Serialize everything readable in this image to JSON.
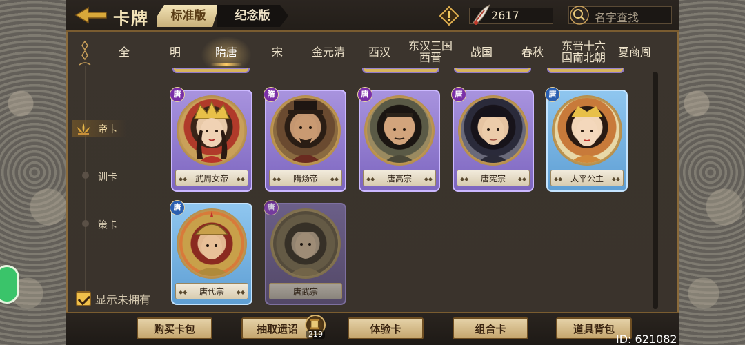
{
  "header": {
    "title": "卡牌",
    "edition_tabs": [
      {
        "label": "标准版",
        "active": true
      },
      {
        "label": "纪念版",
        "active": false
      }
    ],
    "currency_value": "2617",
    "search_placeholder": "名字查找"
  },
  "dynasty_tabs": [
    {
      "label": "全",
      "active": false
    },
    {
      "label": "明",
      "active": false
    },
    {
      "label": "隋唐",
      "active": true
    },
    {
      "label": "宋",
      "active": false
    },
    {
      "label": "金元清",
      "active": false
    },
    {
      "label": "西汉",
      "active": false
    },
    {
      "label": "东汉三国\n西晋",
      "active": false
    },
    {
      "label": "战国",
      "active": false
    },
    {
      "label": "春秋",
      "active": false
    },
    {
      "label": "东晋十六\n国南北朝",
      "active": false
    },
    {
      "label": "夏商周",
      "active": false
    }
  ],
  "side_nav": [
    {
      "label": "帝卡",
      "active": true
    },
    {
      "label": "训卡",
      "active": false
    },
    {
      "label": "策卡",
      "active": false
    }
  ],
  "cards": [
    {
      "name": "武周女帝",
      "badge": "唐",
      "frame": "purple",
      "badge_color": "purple",
      "owned": true
    },
    {
      "name": "隋炀帝",
      "badge": "隋",
      "frame": "purple",
      "badge_color": "purple",
      "owned": true
    },
    {
      "name": "唐高宗",
      "badge": "唐",
      "frame": "purple",
      "badge_color": "purple",
      "owned": true
    },
    {
      "name": "唐宪宗",
      "badge": "唐",
      "frame": "purple",
      "badge_color": "purple",
      "owned": true
    },
    {
      "name": "太平公主",
      "badge": "唐",
      "frame": "blue",
      "badge_color": "blue",
      "owned": true
    },
    {
      "name": "唐代宗",
      "badge": "唐",
      "frame": "blue",
      "badge_color": "blue",
      "owned": true
    },
    {
      "name": "唐武宗",
      "badge": "唐",
      "frame": "dim",
      "badge_color": "purple",
      "owned": false
    }
  ],
  "show_unowned": {
    "label": "显示未拥有",
    "checked": true
  },
  "bottom_buttons": [
    {
      "label": "购买卡包"
    },
    {
      "label": "抽取遗诏"
    },
    {
      "label": "体验卡"
    },
    {
      "label": "组合卡"
    },
    {
      "label": "道具背包"
    }
  ],
  "draw_count": "219",
  "user_id": "ID: 621082",
  "colors": {
    "accent_gold": "#c9a05a",
    "frame_purple": "#a893de",
    "frame_blue": "#8fc6ef",
    "active_tab_glow": "#ffcc66"
  }
}
